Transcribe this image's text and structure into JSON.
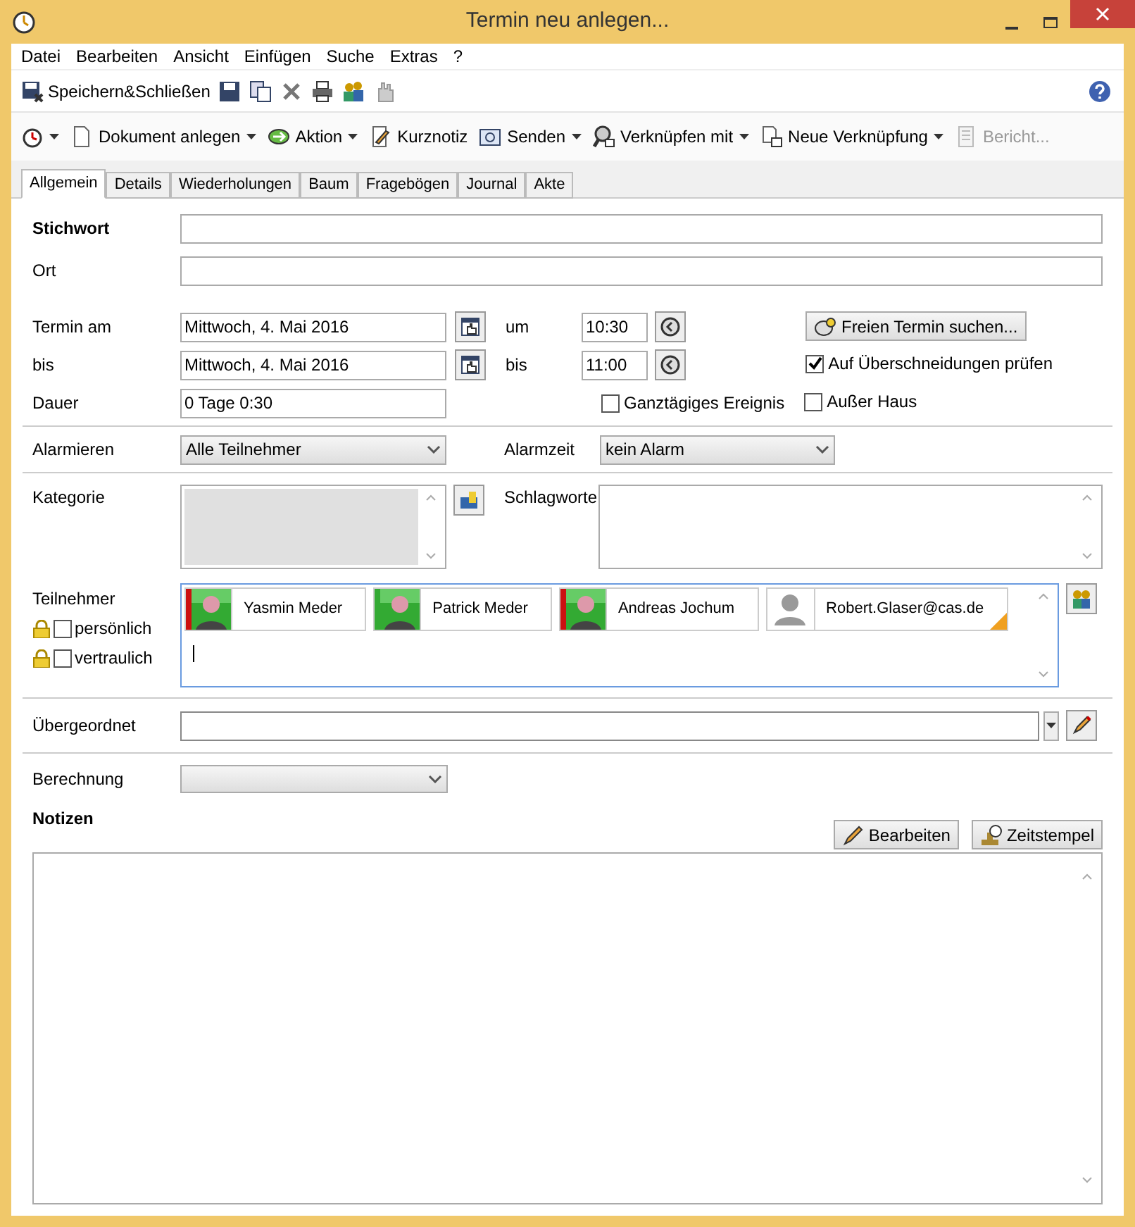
{
  "window": {
    "title": "Termin neu anlegen..."
  },
  "menu": [
    "Datei",
    "Bearbeiten",
    "Ansicht",
    "Einfügen",
    "Suche",
    "Extras",
    "?"
  ],
  "toolbar1": {
    "save_close": "Speichern&Schließen"
  },
  "toolbar2": [
    {
      "kind": "timer",
      "dropdown": true,
      "disabled": false
    },
    {
      "kind": "doc",
      "label": "Dokument anlegen",
      "dropdown": true,
      "disabled": false
    },
    {
      "kind": "action",
      "label": "Aktion",
      "dropdown": true,
      "disabled": false
    },
    {
      "kind": "note",
      "label": "Kurznotiz",
      "dropdown": false,
      "disabled": false
    },
    {
      "kind": "mail",
      "label": "Senden",
      "dropdown": true,
      "disabled": false
    },
    {
      "kind": "link",
      "label": "Verknüpfen mit",
      "dropdown": true,
      "disabled": false
    },
    {
      "kind": "newlink",
      "label": "Neue Verknüpfung",
      "dropdown": true,
      "disabled": false
    },
    {
      "kind": "report",
      "label": "Bericht...",
      "dropdown": false,
      "disabled": true
    }
  ],
  "tabs": [
    {
      "label": "Allgemein",
      "selected": true
    },
    {
      "label": "Details",
      "selected": false
    },
    {
      "label": "Wiederholungen",
      "selected": false
    },
    {
      "label": "Baum",
      "selected": false
    },
    {
      "label": "Fragebögen",
      "selected": false
    },
    {
      "label": "Journal",
      "selected": false
    },
    {
      "label": "Akte",
      "selected": false
    }
  ],
  "stichwort": {
    "label": "Stichwort"
  },
  "ort": {
    "label": "Ort"
  },
  "termin_am": {
    "label": "Termin am",
    "value": "Mittwoch, 4. Mai 2016",
    "time_label": "um",
    "time": "10:30"
  },
  "bis": {
    "label": "bis",
    "value": "Mittwoch, 4. Mai 2016",
    "time_label": "bis",
    "time": "11:00"
  },
  "dauer": {
    "label": "Dauer",
    "value": "0 Tage 0:30"
  },
  "free_slot_button": "Freien Termin suchen...",
  "checks": [
    {
      "label": "Auf Überschneidungen prüfen",
      "checked": true
    },
    {
      "label": "Ganztägiges Ereignis",
      "checked": false
    },
    {
      "label": "Außer Haus",
      "checked": false
    }
  ],
  "alarmieren": {
    "label": "Alarmieren",
    "value": "Alle Teilnehmer"
  },
  "alarmzeit": {
    "label": "Alarmzeit",
    "value": "kein Alarm"
  },
  "kategorie": {
    "label": "Kategorie"
  },
  "schlagworte": {
    "label": "Schlagworte"
  },
  "teilnehmer": {
    "label": "Teilnehmer",
    "options": [
      {
        "label": "persönlich",
        "checked": false
      },
      {
        "label": "vertraulich",
        "checked": false
      }
    ],
    "people": [
      {
        "name": "Yasmin Meder",
        "color": "#cc1111",
        "photo": true
      },
      {
        "name": "Patrick Meder",
        "color": "#33aa33",
        "photo": true
      },
      {
        "name": "Andreas Jochum",
        "color": "#cc1111",
        "photo": true
      },
      {
        "name": "Robert.Glaser@cas.de",
        "photo": false,
        "flag": true
      }
    ]
  },
  "uebergeordnet": {
    "label": "Übergeordnet"
  },
  "berechnung": {
    "label": "Berechnung"
  },
  "notizen": {
    "label": "Notizen",
    "buttons": [
      "Bearbeiten",
      "Zeitstempel"
    ]
  }
}
